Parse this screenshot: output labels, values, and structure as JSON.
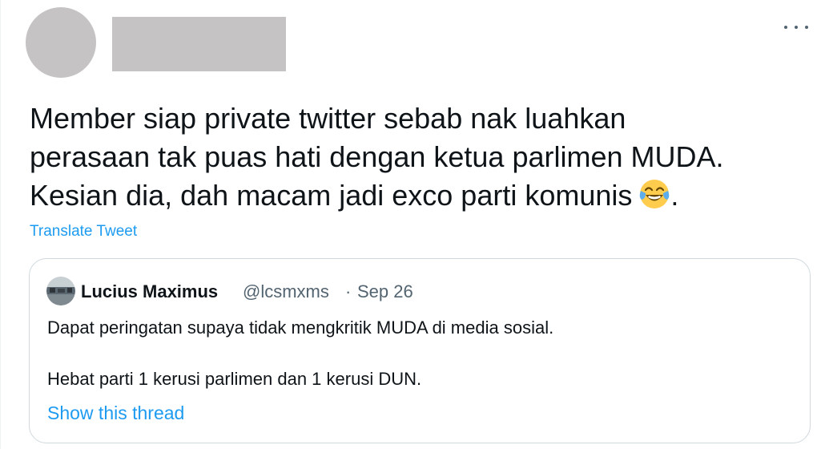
{
  "tweet": {
    "author_name": "",
    "more_icon": "more-horizontal-icon",
    "text_lines": [
      "Member siap private twitter sebab nak luahkan",
      "perasaan tak puas hati dengan ketua parlimen MUDA.",
      "Kesian dia, dah macam jadi exco parti komunis"
    ],
    "emoji_icon": "face-with-tears-of-joy-icon",
    "text_end": ".",
    "translate_label": "Translate Tweet"
  },
  "quote": {
    "display_name": "Lucius Maximus",
    "handle": "@lcsmxms",
    "separator": "·",
    "date": "Sep 26",
    "line1": "Dapat peringatan supaya tidak mengkritik MUDA di media sosial.",
    "line2": "Hebat parti 1 kerusi parlimen dan 1 kerusi DUN.",
    "show_thread_label": "Show this thread"
  },
  "colors": {
    "accent": "#1d9bf0",
    "text": "#0f1419",
    "secondary_text": "#536471",
    "border": "#cfd9de",
    "redaction": "#c6c3c4"
  }
}
